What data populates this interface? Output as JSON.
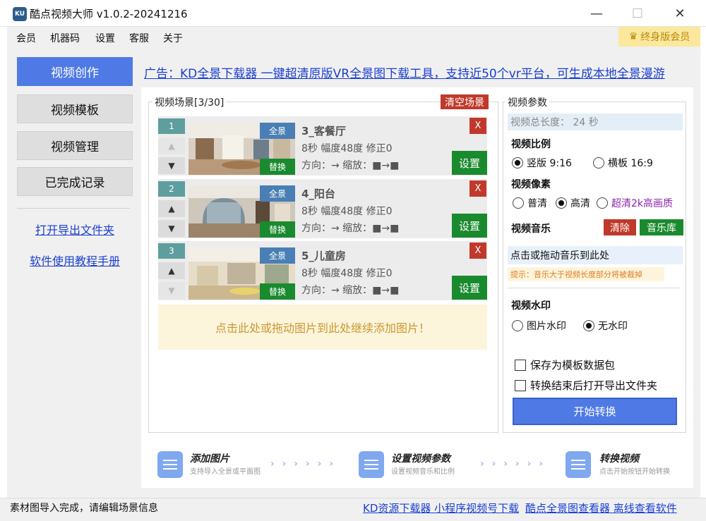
{
  "window": {
    "title": "酷点视频大师 v1.0.2-20241216",
    "icon_label": "KU",
    "minimize": "—",
    "maximize": "☐",
    "close": "✕"
  },
  "menu": [
    "会员",
    "机器码",
    "设置",
    "客服",
    "关于"
  ],
  "vip": {
    "label": "终身版会员",
    "icon": "crown-icon"
  },
  "sidebar": {
    "buttons": [
      "视频创作",
      "视频模板",
      "视频管理",
      "已完成记录"
    ],
    "links": [
      "打开导出文件夹",
      "软件使用教程手册"
    ]
  },
  "ad": {
    "text": "广告：KD全景下载器 一键超清原版VR全景图下载工具，支持近50个vr平台，可生成本地全景漫游"
  },
  "scenes": {
    "title": "视频场景[3/30]",
    "clear_label": "清空场景",
    "full_tag": "全景",
    "replace_tag": "替换",
    "set_label": "设置",
    "delete_label": "X",
    "up_arrow": "▲",
    "down_arrow": "▼",
    "items": [
      {
        "index": "1",
        "name": "3_客餐厅",
        "info": "8秒 幅度48度 修正0",
        "dir": "方向：→ 缩放：■→■"
      },
      {
        "index": "2",
        "name": "4_阳台",
        "info": "8秒 幅度48度 修正0",
        "dir": "方向：→ 缩放：■→■"
      },
      {
        "index": "3",
        "name": "5_儿童房",
        "info": "8秒 幅度48度 修正0",
        "dir": "方向：→ 缩放：■→■"
      }
    ],
    "add_hint": "点击此处或拖动图片到此处继续添加图片！"
  },
  "params": {
    "title": "视频参数",
    "total_length": "视频总长度： 24 秒",
    "ratio_label": "视频比例",
    "ratio_options": [
      "竖版 9:16",
      "横板 16:9"
    ],
    "pixel_label": "视频像素",
    "pixel_options": [
      "普清",
      "高清",
      "超清2k高画质"
    ],
    "music_label": "视频音乐",
    "music_clear": "清除",
    "music_lib": "音乐库",
    "music_drop": "点击或拖动音乐到此处",
    "music_tip": "提示：音乐大于视频长度部分将被裁掉",
    "watermark_label": "视频水印",
    "watermark_options": [
      "图片水印",
      "无水印"
    ],
    "check_template": "保存为模板数据包",
    "check_open_folder": "转换结束后打开导出文件夹",
    "start_label": "开始转换"
  },
  "steps": [
    {
      "title": "添加图片",
      "desc": "支持导入全景或平面图"
    },
    {
      "title": "设置视频参数",
      "desc": "设置视频音乐和比例"
    },
    {
      "title": "转换视频",
      "desc": "点击开始按钮开始转换"
    }
  ],
  "step_arrows": "› › › › › ›",
  "status": {
    "text": "素材图导入完成，请编辑场景信息",
    "links": [
      "KD资源下载器 小程序视频号下载",
      "酷点全景图查看器 离线查看软件"
    ]
  },
  "colors": {
    "accent": "#4f7ae5",
    "danger": "#c0392b",
    "success": "#1a8a2e",
    "link": "#1a3fd0",
    "vip": "#fbe89c"
  }
}
